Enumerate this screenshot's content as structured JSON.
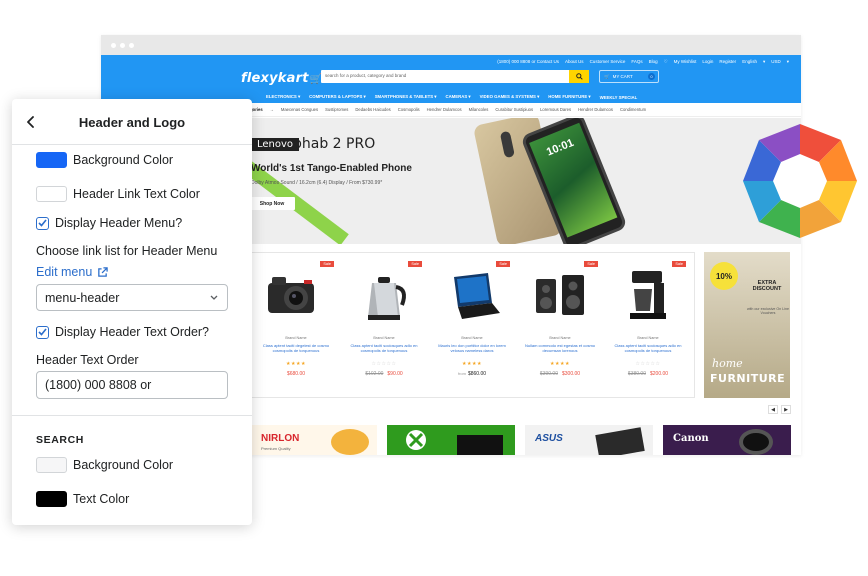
{
  "storefront": {
    "top_links": [
      "(1800) 000 8808 or Contact Us",
      "About Us",
      "Customer Service",
      "FAQs",
      "Blog",
      "My Wishlist",
      "Login",
      "Register",
      "English",
      "USD"
    ],
    "logo": "flexykart",
    "search_placeholder": "search for a product, category and brand",
    "cart_label": "MY CART",
    "cart_count": "0",
    "menu": [
      "ELECTRONICS",
      "COMPUTERS & LAPTOPS",
      "SMARTPHONES & TABLETS",
      "CAMERAS",
      "VIDEO GAMES & SYSTEMS",
      "HOME FURNITURE",
      "WEEKLY SPECIAL"
    ],
    "categories": [
      "Categories",
      "Maecenas Congues",
      "Sustipromes",
      "Dedaebs Haicudes",
      "Cosmopolis",
      "Hendrer Dulamcos",
      "Milancoles",
      "Curabitur Sustipiuos",
      "Loremous Dares",
      "Hendrer Dulamcos",
      "Condimentum"
    ],
    "hero": {
      "brand_lenovo": "Lenovo",
      "brand_phab": "phab 2 PRO",
      "title": "World's 1st Tango-Enabled Phone",
      "subtitle": "Dolby Atmos Sound / 16.2cm (6.4) Display / From $730.99*",
      "button": "Shop Now",
      "phone_clock": "10:01"
    },
    "products": [
      {
        "sale": "Sale",
        "brand": "Brand Name",
        "title": "Class aptent taciti degelest de cosmo cosmopolis de torquenous",
        "stars": "★★★★",
        "old_price": "",
        "price": "$680.00",
        "from": ""
      },
      {
        "sale": "Sale",
        "brand": "Brand Name",
        "title": "Class aptent taciti sociosques adlo en cosmopolis de torquenous",
        "stars": "☆☆☆☆☆",
        "old_price": "$102.00",
        "price": "$90.00",
        "from": ""
      },
      {
        "sale": "Sale",
        "brand": "Brand Name",
        "title": "Mauris leo don porttitor dolor en lorem velosus nameless daros",
        "stars": "★★★★",
        "old_price": "",
        "price": "$860.00",
        "from": "from"
      },
      {
        "sale": "Sale",
        "brand": "Brand Name",
        "title": "Nullam commodo est egestas et cosmo decumsan lorenous",
        "stars": "★★★★",
        "old_price": "$390.00",
        "price": "$300.00",
        "from": ""
      },
      {
        "sale": "Sale",
        "brand": "Brand Name",
        "title": "Class aptent taciti sociosques adlo en cosmopolis de torquenous",
        "stars": "☆☆☆☆☆",
        "old_price": "$380.00",
        "price": "$200.00",
        "from": ""
      }
    ],
    "promo": {
      "badge": "10%",
      "headline": "EXTRA DISCOUNT",
      "text": "with our exclusive On Line Vouchers",
      "home": "home",
      "furniture": "FURNITURE"
    },
    "banners": [
      "NIRLON",
      "Premium Quality",
      "ASUS",
      "Canon"
    ]
  },
  "panel": {
    "title": "Header and Logo",
    "background_color_label": "Background Color",
    "header_link_text_color_label": "Header Link Text Color",
    "display_header_menu_label": "Display Header Menu?",
    "choose_link_list_label": "Choose link list for Header Menu",
    "edit_menu_label": "Edit menu",
    "menu_select_value": "menu-header",
    "display_header_text_order_label": "Display Header Text Order?",
    "header_text_order_label": "Header Text Order",
    "header_text_order_value": "(1800) 000 8808 or",
    "search_section": "SEARCH",
    "search_background_color_label": "Background Color",
    "search_text_color_label": "Text Color"
  },
  "colors": {
    "header_background": "#1666f5",
    "header_link_text": "#ffffff",
    "search_background": "#f6f6f7",
    "search_text": "#000000",
    "accent_link": "#2c6ecb",
    "store_blue": "#2196f3"
  }
}
